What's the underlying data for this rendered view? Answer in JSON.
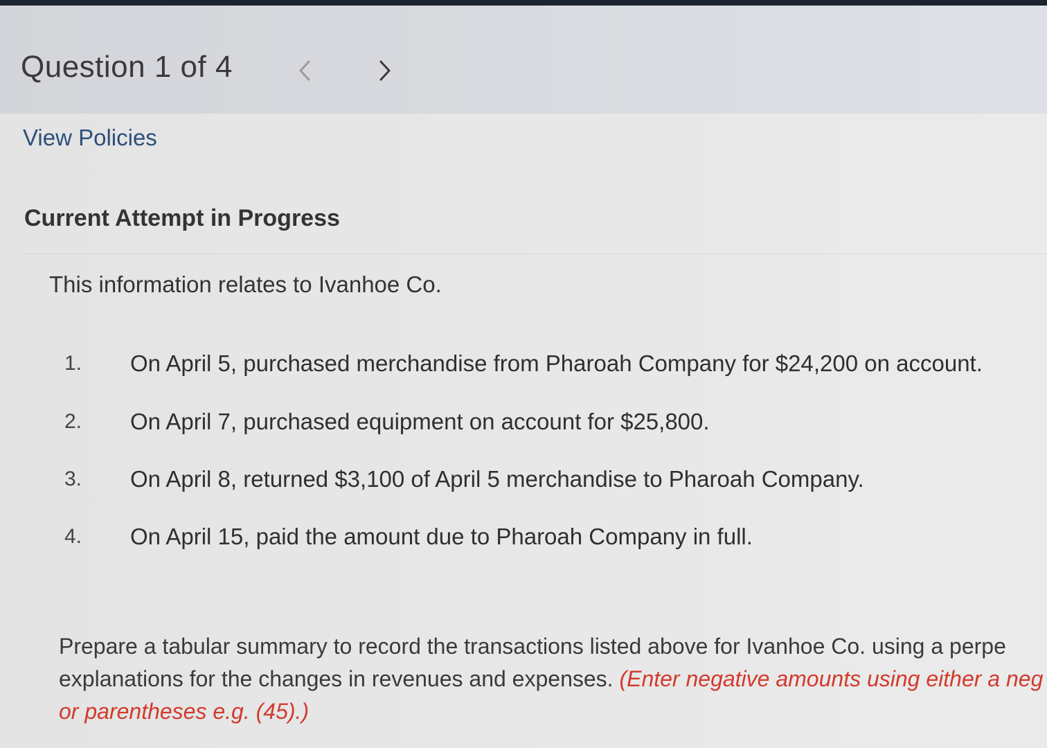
{
  "header": {
    "question_label": "Question 1 of 4",
    "prev_icon": "chevron-left-icon",
    "next_icon": "chevron-right-icon"
  },
  "links": {
    "view_policies": "View Policies"
  },
  "attempt": {
    "heading": "Current Attempt in Progress"
  },
  "problem": {
    "intro": "This information relates to Ivanhoe Co.",
    "transactions": [
      {
        "number": "1.",
        "text": "On April 5, purchased merchandise from Pharoah Company for $24,200 on account."
      },
      {
        "number": "2.",
        "text": "On April 7, purchased equipment on account for $25,800."
      },
      {
        "number": "3.",
        "text": "On April 8, returned $3,100 of April 5 merchandise to Pharoah Company."
      },
      {
        "number": "4.",
        "text": "On April 15, paid the amount due to Pharoah Company in full."
      }
    ],
    "instructions": {
      "line1": "Prepare a tabular summary to record the transactions listed above for Ivanhoe Co. using a perpe",
      "line2_plain": "explanations for the changes in revenues and expenses. ",
      "line2_note": "(Enter negative amounts using either a neg",
      "line3_note": "or parentheses e.g. (45).)"
    }
  },
  "colors": {
    "link": "#2b4f7a",
    "note": "#d33a2c",
    "top_strip": "#1d2330"
  }
}
